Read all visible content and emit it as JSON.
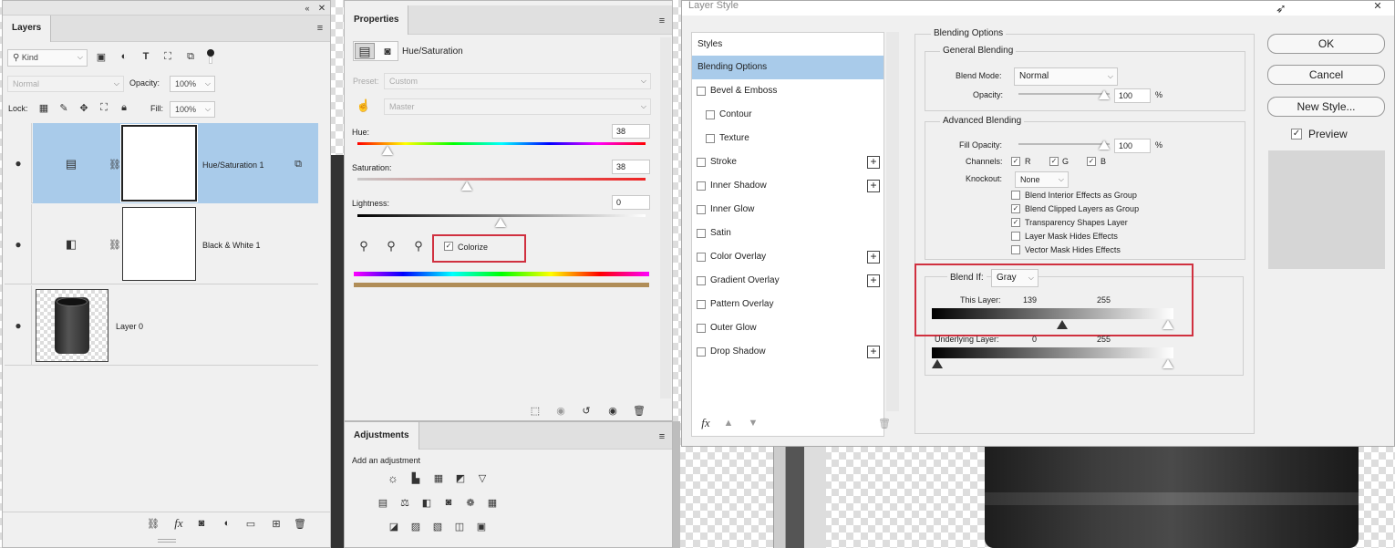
{
  "layers_panel": {
    "tab": "Layers",
    "filter_kind": "Kind",
    "blend_mode": "Normal",
    "opacity_label": "Opacity:",
    "opacity_value": "100%",
    "lock_label": "Lock:",
    "fill_label": "Fill:",
    "fill_value": "100%",
    "layers": [
      {
        "name": "Hue/Saturation 1"
      },
      {
        "name": "Black & White 1"
      },
      {
        "name": "Layer 0"
      }
    ]
  },
  "properties_panel": {
    "tab": "Properties",
    "adjustment_name": "Hue/Saturation",
    "preset_label": "Preset:",
    "preset_value": "Custom",
    "channel_value": "Master",
    "hue_label": "Hue:",
    "hue_value": "38",
    "saturation_label": "Saturation:",
    "saturation_value": "38",
    "lightness_label": "Lightness:",
    "lightness_value": "0",
    "colorize_label": "Colorize",
    "colorize_checked": true
  },
  "adjustments_panel": {
    "tab": "Adjustments",
    "add_label": "Add an adjustment"
  },
  "layer_style": {
    "title": "Layer Style",
    "styles_header": "Styles",
    "styles": [
      {
        "label": "Blending Options",
        "selected": true,
        "checkbox": false,
        "plus": false,
        "indent": false
      },
      {
        "label": "Bevel & Emboss",
        "checkbox": true,
        "plus": false,
        "indent": false
      },
      {
        "label": "Contour",
        "checkbox": true,
        "plus": false,
        "indent": true
      },
      {
        "label": "Texture",
        "checkbox": true,
        "plus": false,
        "indent": true
      },
      {
        "label": "Stroke",
        "checkbox": true,
        "plus": true,
        "indent": false
      },
      {
        "label": "Inner Shadow",
        "checkbox": true,
        "plus": true,
        "indent": false
      },
      {
        "label": "Inner Glow",
        "checkbox": true,
        "plus": false,
        "indent": false
      },
      {
        "label": "Satin",
        "checkbox": true,
        "plus": false,
        "indent": false
      },
      {
        "label": "Color Overlay",
        "checkbox": true,
        "plus": true,
        "indent": false
      },
      {
        "label": "Gradient Overlay",
        "checkbox": true,
        "plus": true,
        "indent": false
      },
      {
        "label": "Pattern Overlay",
        "checkbox": true,
        "plus": false,
        "indent": false
      },
      {
        "label": "Outer Glow",
        "checkbox": true,
        "plus": false,
        "indent": false
      },
      {
        "label": "Drop Shadow",
        "checkbox": true,
        "plus": true,
        "indent": false
      }
    ],
    "fx_label": "fx",
    "blending_options_title": "Blending Options",
    "general_blending_title": "General Blending",
    "blend_mode_label": "Blend Mode:",
    "blend_mode_value": "Normal",
    "opacity_label": "Opacity:",
    "opacity_value": "100",
    "percent": "%",
    "advanced_blending_title": "Advanced Blending",
    "fill_opacity_label": "Fill Opacity:",
    "fill_opacity_value": "100",
    "channels_label": "Channels:",
    "channel_r": "R",
    "channel_g": "G",
    "channel_b": "B",
    "knockout_label": "Knockout:",
    "knockout_value": "None",
    "options": [
      {
        "label": "Blend Interior Effects as Group",
        "checked": false
      },
      {
        "label": "Blend Clipped Layers as Group",
        "checked": true
      },
      {
        "label": "Transparency Shapes Layer",
        "checked": true
      },
      {
        "label": "Layer Mask Hides Effects",
        "checked": false
      },
      {
        "label": "Vector Mask Hides Effects",
        "checked": false
      }
    ],
    "blend_if_label": "Blend If:",
    "blend_if_value": "Gray",
    "this_layer_label": "This Layer:",
    "this_layer_low": "139",
    "this_layer_high": "255",
    "underlying_label": "Underlying Layer:",
    "underlying_low": "0",
    "underlying_high": "255",
    "ok_label": "OK",
    "cancel_label": "Cancel",
    "new_style_label": "New Style...",
    "preview_label": "Preview",
    "preview_checked": true
  },
  "check_mark": "✓",
  "colors": {
    "accent_selected": "#a9cbea",
    "highlight_red": "#d0303f",
    "colorize_bar": "#b08d57"
  }
}
